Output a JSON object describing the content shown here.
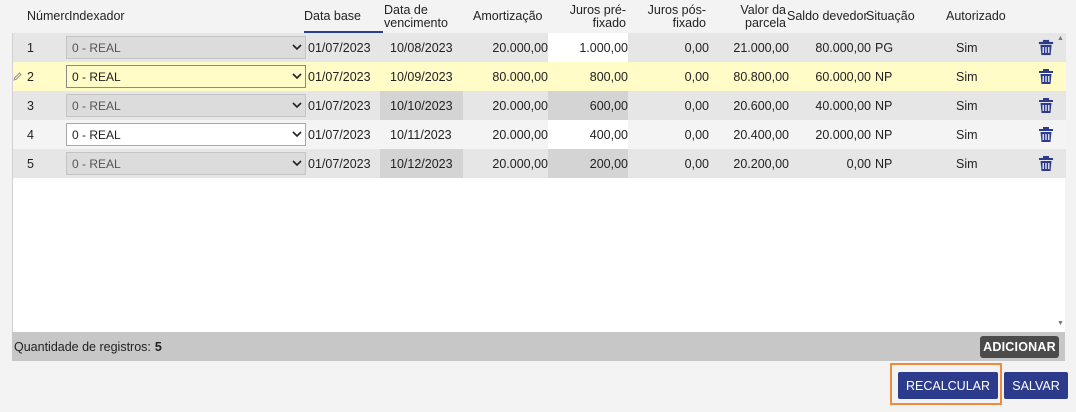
{
  "header": {
    "numero": "Número",
    "indexador": "Indexador",
    "data_base": "Data base",
    "data_vencimento_1": "Data de",
    "data_vencimento_2": "vencimento",
    "amortizacao": "Amortização",
    "juros_pre_1": "Juros pré-",
    "juros_pre_2": "fixado",
    "juros_pos_1": "Juros pós-",
    "juros_pos_2": "fixado",
    "valor_parcela_1": "Valor da",
    "valor_parcela_2": "parcela",
    "saldo_devedor": "Saldo devedor",
    "situacao": "Situação",
    "autorizado": "Autorizado"
  },
  "rows": [
    {
      "numero": "1",
      "indexador": "0 - REAL",
      "data_base": "01/07/2023",
      "data_vencimento": "10/08/2023",
      "amortizacao": "20.000,00",
      "juros_pre": "1.000,00",
      "juros_pos": "0,00",
      "valor_parcela": "21.000,00",
      "saldo_devedor": "80.000,00",
      "situacao": "PG",
      "autorizado": "Sim"
    },
    {
      "numero": "2",
      "indexador": "0 - REAL",
      "data_base": "01/07/2023",
      "data_vencimento": "10/09/2023",
      "amortizacao": "80.000,00",
      "juros_pre": "800,00",
      "juros_pos": "0,00",
      "valor_parcela": "80.800,00",
      "saldo_devedor": "60.000,00",
      "situacao": "NP",
      "autorizado": "Sim"
    },
    {
      "numero": "3",
      "indexador": "0 - REAL",
      "data_base": "01/07/2023",
      "data_vencimento": "10/10/2023",
      "amortizacao": "20.000,00",
      "juros_pre": "600,00",
      "juros_pos": "0,00",
      "valor_parcela": "20.600,00",
      "saldo_devedor": "40.000,00",
      "situacao": "NP",
      "autorizado": "Sim"
    },
    {
      "numero": "4",
      "indexador": "0 - REAL",
      "data_base": "01/07/2023",
      "data_vencimento": "10/11/2023",
      "amortizacao": "20.000,00",
      "juros_pre": "400,00",
      "juros_pos": "0,00",
      "valor_parcela": "20.400,00",
      "saldo_devedor": "20.000,00",
      "situacao": "NP",
      "autorizado": "Sim"
    },
    {
      "numero": "5",
      "indexador": "0 - REAL",
      "data_base": "01/07/2023",
      "data_vencimento": "10/12/2023",
      "amortizacao": "20.000,00",
      "juros_pre": "200,00",
      "juros_pos": "0,00",
      "valor_parcela": "20.200,00",
      "saldo_devedor": "0,00",
      "situacao": "NP",
      "autorizado": "Sim"
    }
  ],
  "footer": {
    "count_label": "Quantidade de registros:",
    "count_value": "5",
    "add_label": "ADICIONAR"
  },
  "actions": {
    "recalc_label": "RECALCULAR",
    "save_label": "SALVAR"
  },
  "icons": {
    "row_edit": "pencil-icon",
    "row_delete": "trash-icon",
    "select_chevron": "chevron-down-icon"
  },
  "colors": {
    "primary": "#2d3b8c",
    "highlight_border": "#f08a3c",
    "selected_row": "#fffcc8",
    "delete_icon": "#2d3b8c",
    "add_button": "#4b4b4b"
  }
}
